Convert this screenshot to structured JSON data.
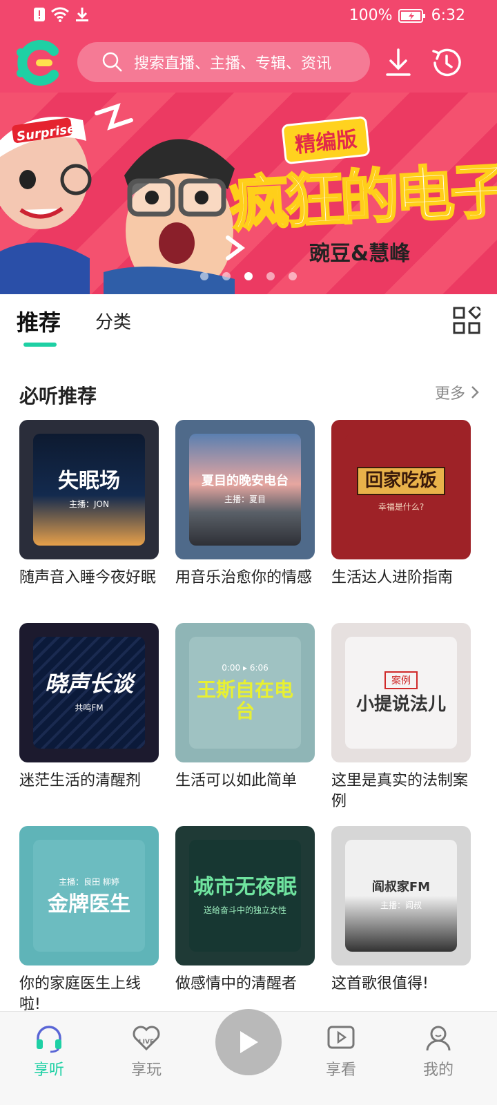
{
  "status_bar": {
    "battery": "100%",
    "time": "6:32"
  },
  "header": {
    "search_placeholder": "搜索直播、主播、专辑、资讯"
  },
  "banner": {
    "tag": "精编版",
    "title": "疯狂的电子",
    "hosts": "豌豆&慧峰",
    "badge_text": "Surprise",
    "dot_count": 5,
    "active_dot": 2
  },
  "tabs": [
    {
      "label": "推荐",
      "active": true
    },
    {
      "label": "分类",
      "active": false
    }
  ],
  "section": {
    "title": "必听推荐",
    "more_label": "更多"
  },
  "cards": [
    {
      "title": "随声音入睡今夜好眠",
      "cover_text": "失眠场",
      "cover_sub": "主播：JON"
    },
    {
      "title": "用音乐治愈你的情感",
      "cover_text": "夏目的晚安电台",
      "cover_sub": "主播：夏目"
    },
    {
      "title": "生活达人进阶指南",
      "cover_text": "回家吃饭",
      "cover_sub": "幸福是什么?"
    },
    {
      "title": "迷茫生活的清醒剂",
      "cover_text": "晓声长谈",
      "cover_sub": "共鸣FM"
    },
    {
      "title": "生活可以如此简单",
      "cover_text": "王斯自在电台",
      "cover_sub": "0:00 ▸ 6:06"
    },
    {
      "title": "这里是真实的法制案例",
      "cover_text": "小提说法儿",
      "cover_sub": "案例"
    },
    {
      "title": "你的家庭医生上线啦!",
      "cover_text": "金牌医生",
      "cover_sub": "主播：良田 柳婷"
    },
    {
      "title": "做感情中的清醒者",
      "cover_text": "城市无夜眠",
      "cover_sub": "送给奋斗中的独立女性"
    },
    {
      "title": "这首歌很值得!",
      "cover_text": "阎叔家FM",
      "cover_sub": "主播：阎叔"
    }
  ],
  "bottom_nav": [
    {
      "label": "享听",
      "icon": "headphones-icon",
      "active": true
    },
    {
      "label": "享玩",
      "icon": "live-heart-icon",
      "active": false
    },
    {
      "label": "",
      "icon": "play-icon",
      "active": false
    },
    {
      "label": "享看",
      "icon": "video-icon",
      "active": false
    },
    {
      "label": "我的",
      "icon": "user-icon",
      "active": false
    }
  ],
  "colors": {
    "brand_pink": "#f2476d",
    "accent_green": "#1ed0a4"
  }
}
